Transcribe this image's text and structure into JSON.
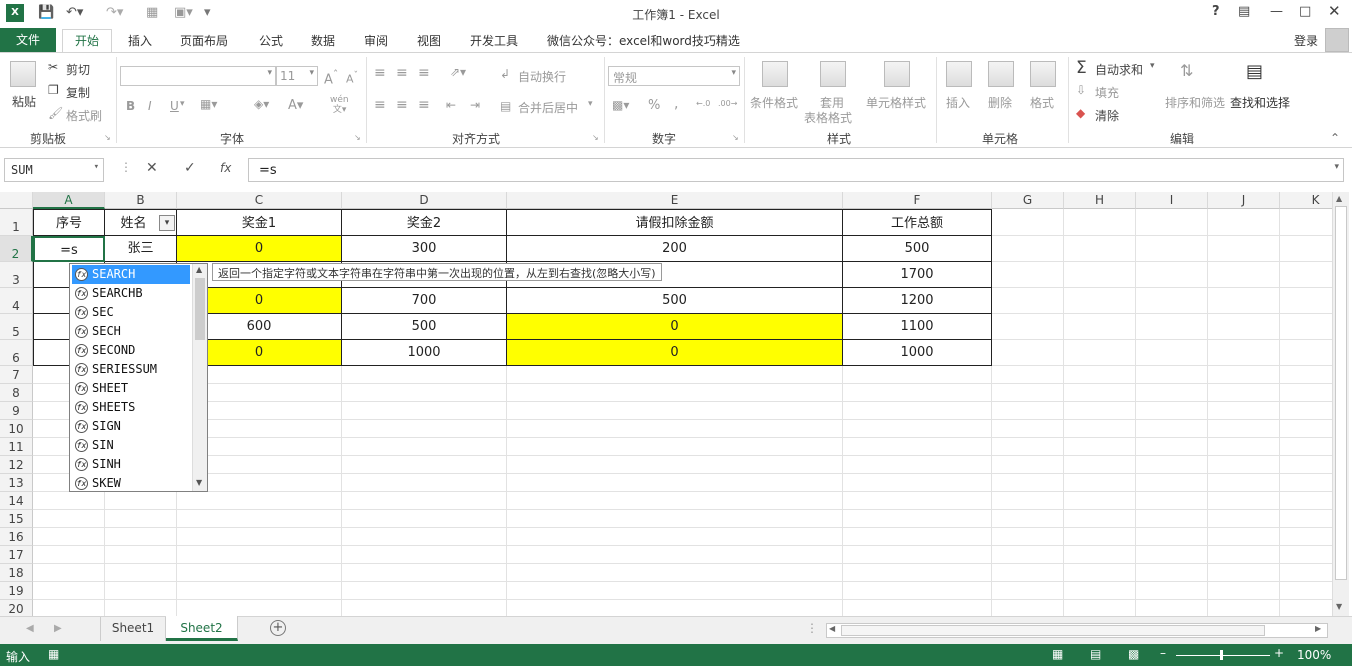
{
  "window": {
    "title": "工作簿1 - Excel",
    "help": "?",
    "login": "登录"
  },
  "ribbon_tabs": [
    "文件",
    "开始",
    "插入",
    "页面布局",
    "公式",
    "数据",
    "审阅",
    "视图",
    "开发工具",
    "微信公众号：excel和word技巧精选"
  ],
  "clipboard": {
    "paste": "粘贴",
    "cut": "剪切",
    "copy": "复制",
    "format_painter": "格式刷",
    "group": "剪贴板"
  },
  "font": {
    "size": "11",
    "group": "字体",
    "bold": "B",
    "italic": "I",
    "underline": "U",
    "wen": "wén",
    "grow": "A",
    "shrink": "A"
  },
  "alignment": {
    "wrap": "自动换行",
    "merge": "合并后居中",
    "group": "对齐方式"
  },
  "number": {
    "format": "常规",
    "percent": "%",
    "comma": ",",
    "group": "数字"
  },
  "styles": {
    "conditional": "条件格式",
    "table_fmt_1": "套用",
    "table_fmt_2": "表格格式",
    "cell_styles": "单元格样式",
    "group": "样式"
  },
  "cells": {
    "insert": "插入",
    "delete": "删除",
    "format": "格式",
    "group": "单元格"
  },
  "editing": {
    "autosum": "自动求和",
    "fill": "填充",
    "clear": "清除",
    "sort": "排序和筛选",
    "find": "查找和选择",
    "group": "编辑"
  },
  "formula_bar": {
    "name_box": "SUM",
    "formula": "=s",
    "fx": "fx"
  },
  "columns": [
    "A",
    "B",
    "C",
    "D",
    "E",
    "F",
    "G",
    "H",
    "I",
    "J",
    "K"
  ],
  "rows": [
    "1",
    "2",
    "3",
    "4",
    "5",
    "6",
    "7",
    "8",
    "9",
    "10",
    "11",
    "12",
    "13",
    "14",
    "15",
    "16",
    "17",
    "18",
    "19",
    "20"
  ],
  "table": {
    "headers": [
      "序号",
      "姓名",
      "奖金1",
      "奖金2",
      "请假扣除金额",
      "工作总额"
    ],
    "data": [
      [
        "=s",
        "张三",
        "0",
        "300",
        "200",
        "500"
      ],
      [
        "",
        "",
        "",
        "",
        "",
        "1700"
      ],
      [
        "",
        "",
        "0",
        "700",
        "500",
        "1200"
      ],
      [
        "",
        "",
        "600",
        "500",
        "0",
        "1100"
      ],
      [
        "",
        "",
        "0",
        "1000",
        "0",
        "1000"
      ]
    ]
  },
  "autocomplete": [
    "SEARCH",
    "SEARCHB",
    "SEC",
    "SECH",
    "SECOND",
    "SERIESSUM",
    "SHEET",
    "SHEETS",
    "SIGN",
    "SIN",
    "SINH",
    "SKEW"
  ],
  "tooltip": "返回一个指定字符或文本字符串在字符串中第一次出现的位置，从左到右查找(忽略大小写)",
  "sheets": [
    "Sheet1",
    "Sheet2"
  ],
  "status": {
    "mode": "输入",
    "zoom": "100%"
  },
  "colors": {
    "excel_green": "#217346",
    "highlight": "#ffff00",
    "selection": "#3399ff"
  }
}
